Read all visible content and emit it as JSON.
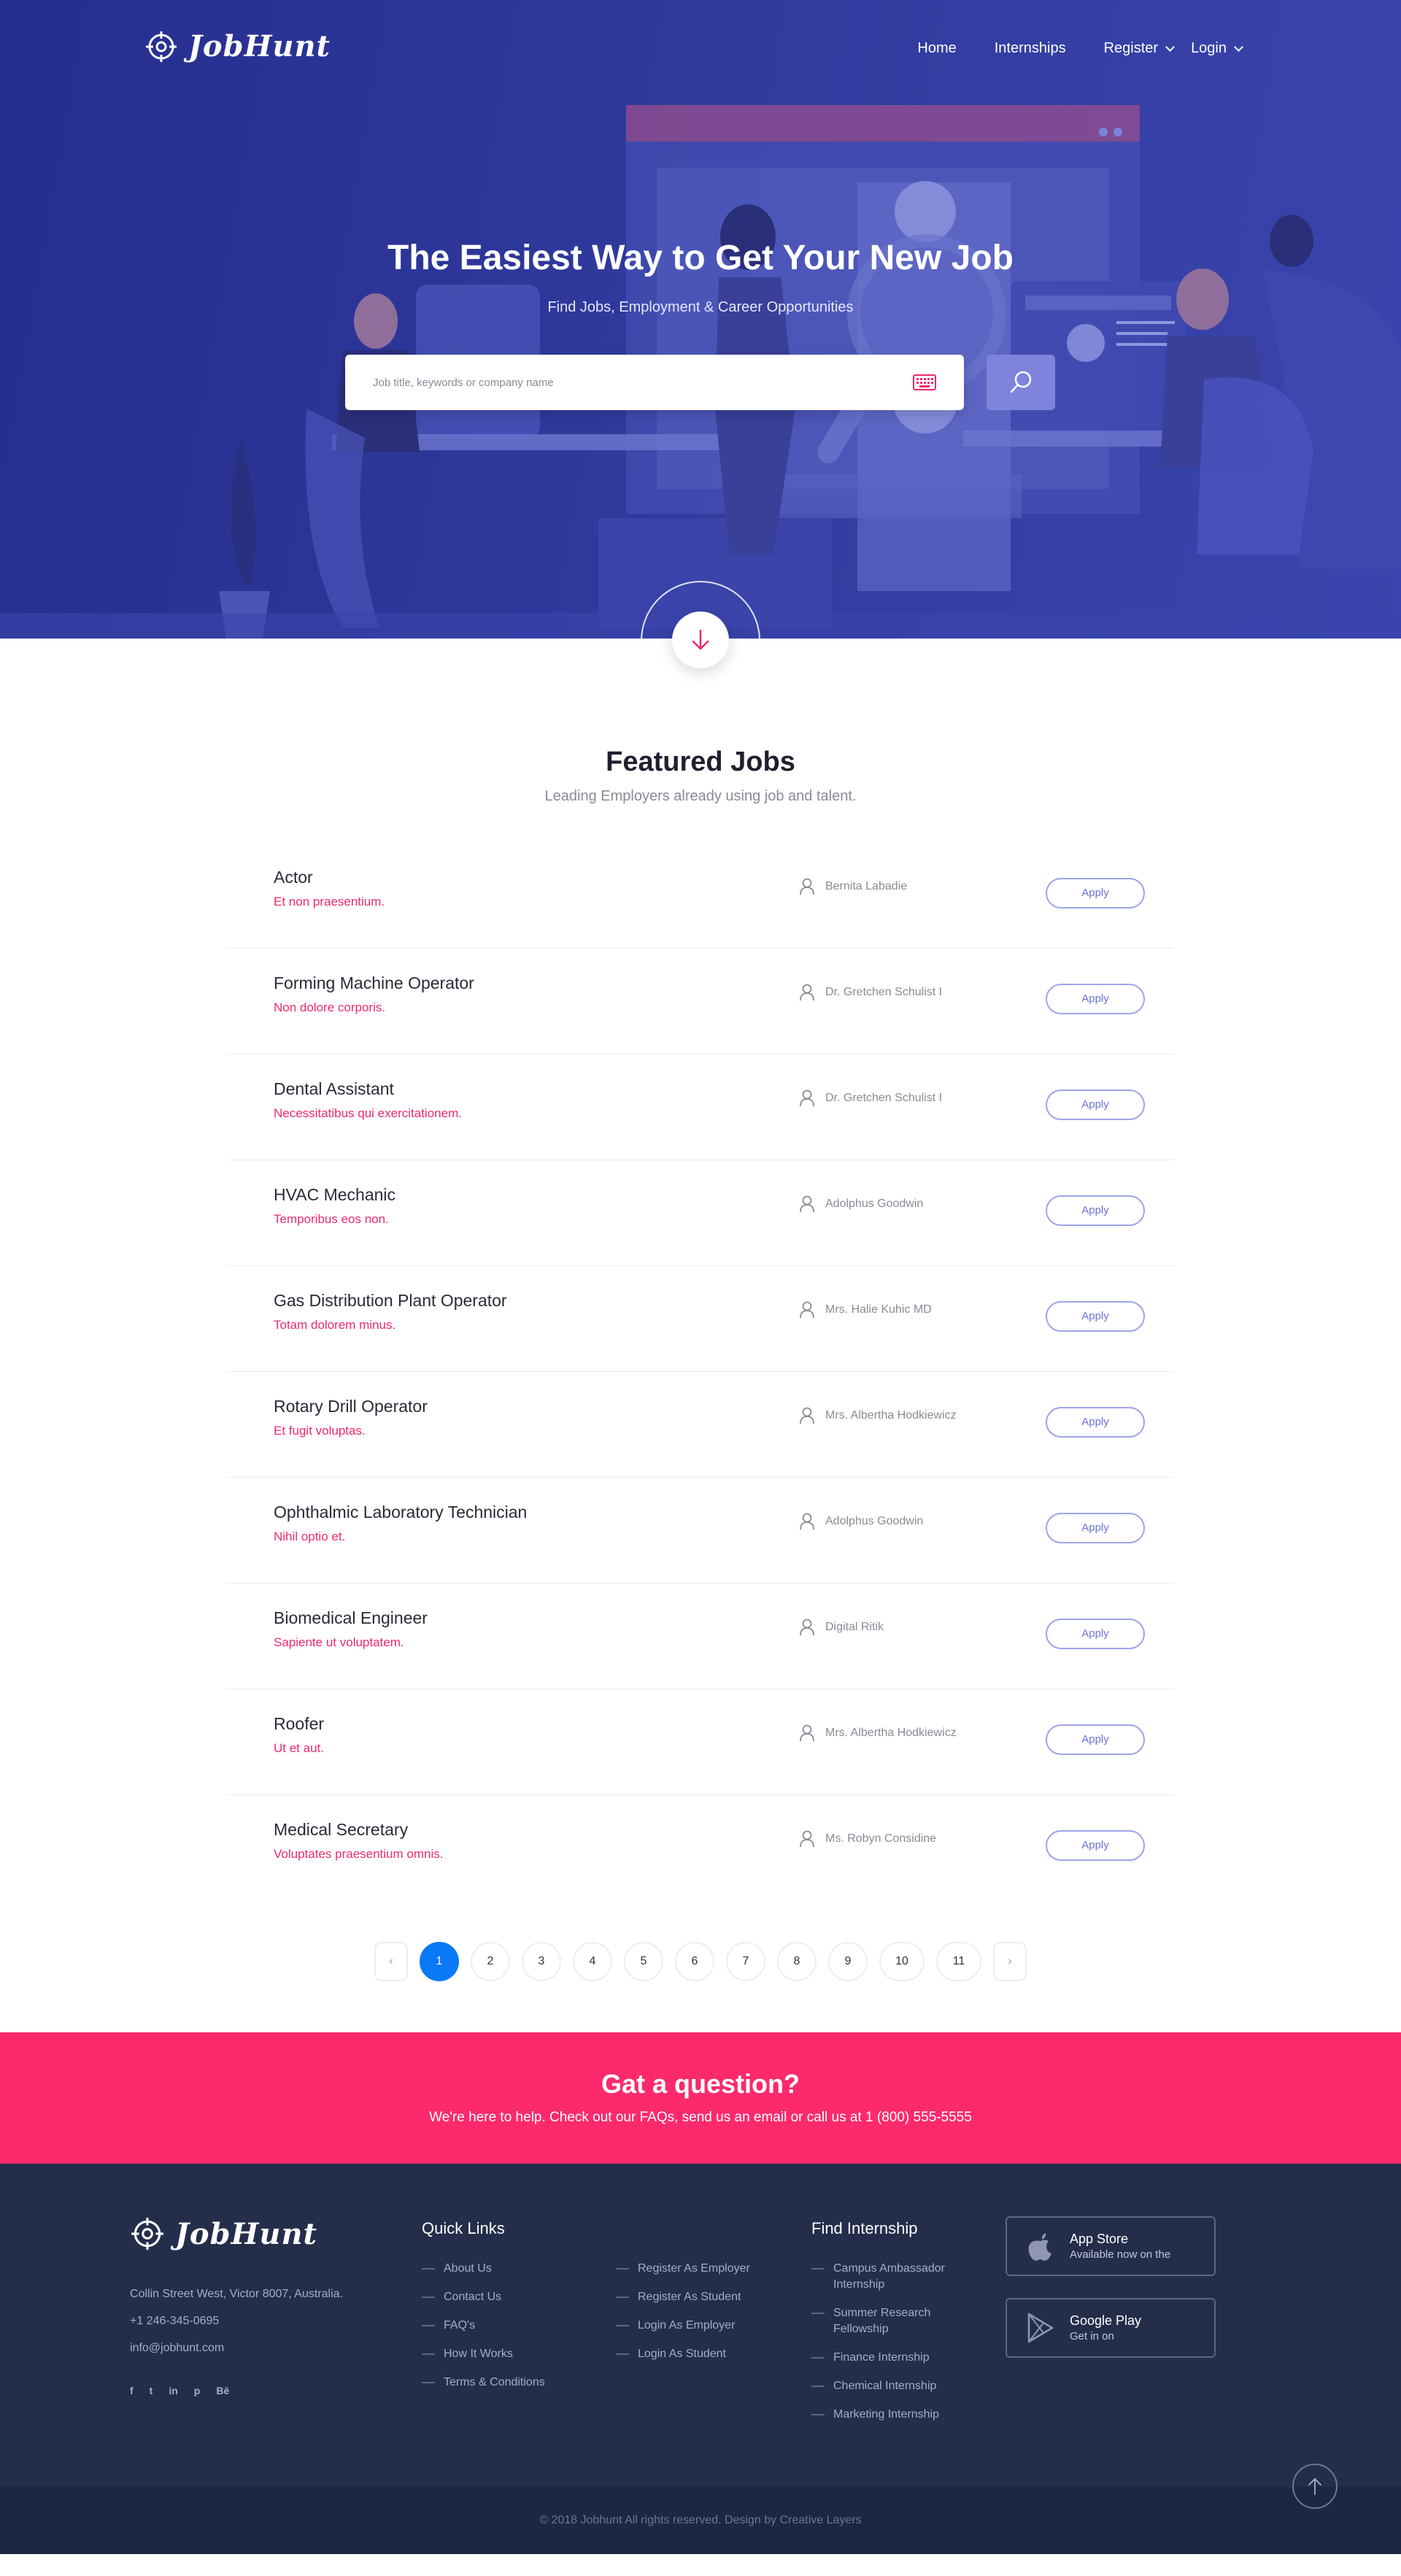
{
  "brand": {
    "name": "JobHunt"
  },
  "nav": {
    "items": [
      {
        "label": "Home"
      },
      {
        "label": "Internships"
      },
      {
        "label": "Register"
      },
      {
        "label": "Login"
      }
    ]
  },
  "hero": {
    "title": "The Easiest Way to Get Your New Job",
    "subtitle": "Find Jobs, Employment & Career Opportunities",
    "search_placeholder": "Job title, keywords or company name"
  },
  "featured": {
    "title": "Featured Jobs",
    "subtitle": "Leading Employers already using job and talent.",
    "apply_label": "Apply",
    "jobs": [
      {
        "title": "Actor",
        "company": "Et non praesentium.",
        "person": "Bernita Labadie"
      },
      {
        "title": "Forming Machine Operator",
        "company": "Non dolore corporis.",
        "person": "Dr. Gretchen Schulist I"
      },
      {
        "title": "Dental Assistant",
        "company": "Necessitatibus qui exercitationem.",
        "person": "Dr. Gretchen Schulist I"
      },
      {
        "title": "HVAC Mechanic",
        "company": "Temporibus eos non.",
        "person": "Adolphus Goodwin"
      },
      {
        "title": "Gas Distribution Plant Operator",
        "company": "Totam dolorem minus.",
        "person": "Mrs. Halie Kuhic MD"
      },
      {
        "title": "Rotary Drill Operator",
        "company": "Et fugit voluptas.",
        "person": "Mrs. Albertha Hodkiewicz"
      },
      {
        "title": "Ophthalmic Laboratory Technician",
        "company": "Nihil optio et.",
        "person": "Adolphus Goodwin"
      },
      {
        "title": "Biomedical Engineer",
        "company": "Sapiente ut voluptatem.",
        "person": "Digital Ritik"
      },
      {
        "title": "Roofer",
        "company": "Ut et aut.",
        "person": "Mrs. Albertha Hodkiewicz"
      },
      {
        "title": "Medical Secretary",
        "company": "Voluptates praesentium omnis.",
        "person": "Ms. Robyn Considine"
      }
    ]
  },
  "pagination": {
    "prev": "‹",
    "next": "›",
    "pages": [
      "1",
      "2",
      "3",
      "4",
      "5",
      "6",
      "7",
      "8",
      "9",
      "10",
      "11"
    ],
    "current": "1"
  },
  "cta": {
    "title": "Gat a question?",
    "text": "We're here to help. Check out our FAQs, send us an email or call us at 1 (800) 555-5555"
  },
  "footer": {
    "address": "Collin Street West, Victor 8007, Australia.",
    "phone": "+1 246-345-0695",
    "email": "info@jobhunt.com",
    "social": [
      {
        "icon": "facebook-icon",
        "glyph": "f"
      },
      {
        "icon": "twitter-icon",
        "glyph": "t"
      },
      {
        "icon": "linkedin-icon",
        "glyph": "in"
      },
      {
        "icon": "pinterest-icon",
        "glyph": "p"
      },
      {
        "icon": "behance-icon",
        "glyph": "Bē"
      }
    ],
    "quick_links_title": "Quick Links",
    "quick_links_a": [
      "About Us",
      "Contact Us",
      "FAQ's",
      "How It Works",
      "Terms & Conditions"
    ],
    "quick_links_b": [
      "Register As Employer",
      "Register As Student",
      "Login As Employer",
      "Login As Student"
    ],
    "internship_title": "Find Internship",
    "internships": [
      "Campus Ambassador Internship",
      "Summer Research Fellowship",
      "Finance Internship",
      "Chemical Internship",
      "Marketing Internship"
    ],
    "app_store": {
      "title": "App Store",
      "sub": "Available now on the"
    },
    "google_play": {
      "title": "Google Play",
      "sub": "Get in on"
    },
    "copyright": "© 2018 Jobhunt All rights reserved. Design by Creative Layers"
  },
  "colors": {
    "hero_bg": "#2d3696",
    "accent_pink": "#fc2a6d",
    "active_page": "#0a79f6",
    "footer_bg": "#242e4b"
  }
}
